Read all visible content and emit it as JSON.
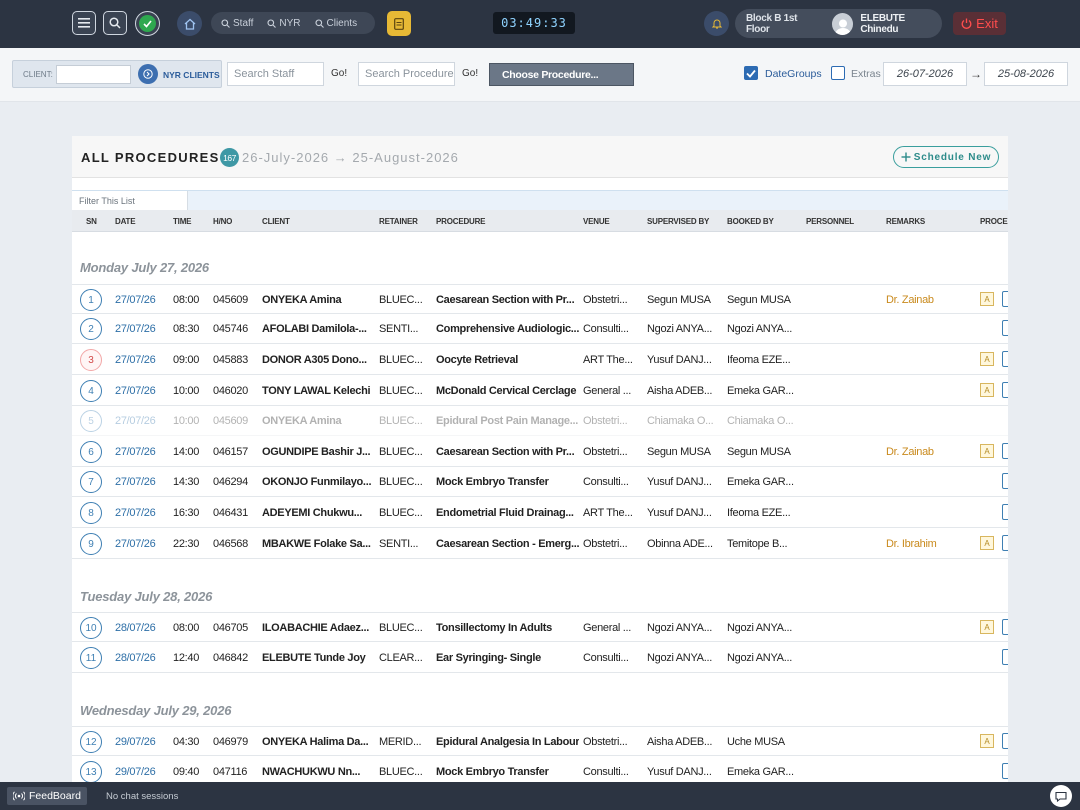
{
  "topbar": {
    "nav_pills": [
      {
        "label": "Staff",
        "icon": "search-icon"
      },
      {
        "label": "NYR",
        "icon": "search-icon"
      },
      {
        "label": "Clients",
        "icon": "search-icon"
      }
    ],
    "clock": "03:49:33",
    "location": "Block B 1st Floor",
    "user_name": "ELEBUTE Chinedu",
    "exit_label": "Exit",
    "colors": {
      "accent_green": "#2ea84f",
      "doc_yellow": "#e7b935",
      "exit_red": "#ff4d4d"
    }
  },
  "filters": {
    "client_label": "CLIENT:",
    "client_value": "",
    "nyr_clients_label": "NYR CLIENTS",
    "staff_placeholder": "Search Staff",
    "go_label": "Go!",
    "procedure_placeholder": "Search Procedure",
    "choose_procedure_label": "Choose Procedure...",
    "date_groups_label": "DateGroups",
    "date_groups_checked": true,
    "extras_label": "Extras",
    "extras_checked": false,
    "date_from": "26-07-2026",
    "date_to": "25-08-2026",
    "date_arrow": "→"
  },
  "panel": {
    "title": "ALL PROCEDURES ::",
    "count": "167",
    "range": "26-July-2026 → 25-August-2026",
    "schedule_new_label": "Schedule New",
    "filter_placeholder": "Filter This List",
    "columns": [
      "SN",
      "DATE",
      "TIME",
      "H/NO",
      "CLIENT",
      "RETAINER",
      "PROCEDURE",
      "VENUE",
      "SUPERVISED BY",
      "BOOKED BY",
      "PERSONNEL",
      "REMARKS",
      "PROCE"
    ]
  },
  "groups": [
    {
      "title": "Monday July 27, 2026",
      "rows": [
        {
          "sn": "1",
          "date": "27/07/26",
          "time": "08:00",
          "hno": "045609",
          "client": "ONYEKA Amina",
          "retainer": "BLUEC...",
          "procedure": "Caesarean Section with Pr...",
          "venue": "Obstetri...",
          "supervised": "Segun MUSA",
          "booked": "Segun MUSA",
          "remarks": "Dr. Zainab",
          "badge": "A"
        },
        {
          "sn": "2",
          "date": "27/07/26",
          "time": "08:30",
          "hno": "045746",
          "client": "AFOLABI Damilola-...",
          "retainer": "SENTI...",
          "procedure": "Comprehensive Audiologic...",
          "venue": "Consulti...",
          "supervised": "Ngozi ANYA...",
          "booked": "Ngozi ANYA...",
          "remarks": "",
          "badge": ""
        },
        {
          "sn": "3",
          "date": "27/07/26",
          "time": "09:00",
          "hno": "045883",
          "client": "DONOR A305 Dono...",
          "retainer": "BLUEC...",
          "procedure": "Oocyte Retrieval",
          "venue": "ART The...",
          "supervised": "Yusuf DANJ...",
          "booked": "Ifeoma EZE...",
          "remarks": "",
          "badge": "A"
        },
        {
          "sn": "4",
          "date": "27/07/26",
          "time": "10:00",
          "hno": "046020",
          "client": "TONY LAWAL Kelechi",
          "retainer": "BLUEC...",
          "procedure": "McDonald Cervical Cerclage",
          "venue": "General ...",
          "supervised": "Aisha ADEB...",
          "booked": "Emeka GAR...",
          "remarks": "",
          "badge": "A"
        },
        {
          "sn": "5",
          "date": "27/07/26",
          "time": "10:00",
          "hno": "045609",
          "client": "ONYEKA Amina",
          "retainer": "BLUEC...",
          "procedure": "Epidural Post Pain Manage...",
          "venue": "Obstetri...",
          "supervised": "Chiamaka O...",
          "booked": "Chiamaka O...",
          "remarks": "",
          "badge": ""
        },
        {
          "sn": "6",
          "date": "27/07/26",
          "time": "14:00",
          "hno": "046157",
          "client": "OGUNDIPE Bashir J...",
          "retainer": "BLUEC...",
          "procedure": "Caesarean Section with Pr...",
          "venue": "Obstetri...",
          "supervised": "Segun MUSA",
          "booked": "Segun MUSA",
          "remarks": "Dr. Zainab",
          "badge": "A"
        },
        {
          "sn": "7",
          "date": "27/07/26",
          "time": "14:30",
          "hno": "046294",
          "client": "OKONJO Funmilayo...",
          "retainer": "BLUEC...",
          "procedure": "Mock Embryo Transfer",
          "venue": "Consulti...",
          "supervised": "Yusuf DANJ...",
          "booked": "Emeka GAR...",
          "remarks": "",
          "badge": ""
        },
        {
          "sn": "8",
          "date": "27/07/26",
          "time": "16:30",
          "hno": "046431",
          "client": "ADEYEMI Chukwu...",
          "retainer": "BLUEC...",
          "procedure": "Endometrial Fluid Drainag...",
          "venue": "ART The...",
          "supervised": "Yusuf DANJ...",
          "booked": "Ifeoma EZE...",
          "remarks": "",
          "badge": ""
        },
        {
          "sn": "9",
          "date": "27/07/26",
          "time": "22:30",
          "hno": "046568",
          "client": "MBAKWE Folake Sa...",
          "retainer": "SENTI...",
          "procedure": "Caesarean Section - Emerg...",
          "venue": "Obstetri...",
          "supervised": "Obinna ADE...",
          "booked": "Temitope B...",
          "remarks": "Dr. Ibrahim",
          "badge": "A"
        }
      ]
    },
    {
      "title": "Tuesday July 28, 2026",
      "rows": [
        {
          "sn": "10",
          "date": "28/07/26",
          "time": "08:00",
          "hno": "046705",
          "client": "ILOABACHIE Adaez...",
          "retainer": "BLUEC...",
          "procedure": "Tonsillectomy In Adults",
          "venue": "General ...",
          "supervised": "Ngozi ANYA...",
          "booked": "Ngozi ANYA...",
          "remarks": "",
          "badge": "A"
        },
        {
          "sn": "11",
          "date": "28/07/26",
          "time": "12:40",
          "hno": "046842",
          "client": "ELEBUTE Tunde Joy",
          "retainer": "CLEAR...",
          "procedure": "Ear Syringing- Single",
          "venue": "Consulti...",
          "supervised": "Ngozi ANYA...",
          "booked": "Ngozi ANYA...",
          "remarks": "",
          "badge": ""
        }
      ]
    },
    {
      "title": "Wednesday July 29, 2026",
      "rows": [
        {
          "sn": "12",
          "date": "29/07/26",
          "time": "04:30",
          "hno": "046979",
          "client": "ONYEKA Halima Da...",
          "retainer": "MERID...",
          "procedure": "Epidural Analgesia In Labour",
          "venue": "Obstetri...",
          "supervised": "Aisha ADEB...",
          "booked": "Uche MUSA",
          "remarks": "",
          "badge": "A"
        },
        {
          "sn": "13",
          "date": "29/07/26",
          "time": "09:40",
          "hno": "047116",
          "client": "NWACHUKWU Nn...",
          "retainer": "BLUEC...",
          "procedure": "Mock Embryo Transfer",
          "venue": "Consulti...",
          "supervised": "Yusuf DANJ...",
          "booked": "Emeka GAR...",
          "remarks": "",
          "badge": ""
        }
      ]
    }
  ],
  "bottombar": {
    "feedboard_label": "FeedBoard",
    "chat_status": "No chat sessions"
  }
}
